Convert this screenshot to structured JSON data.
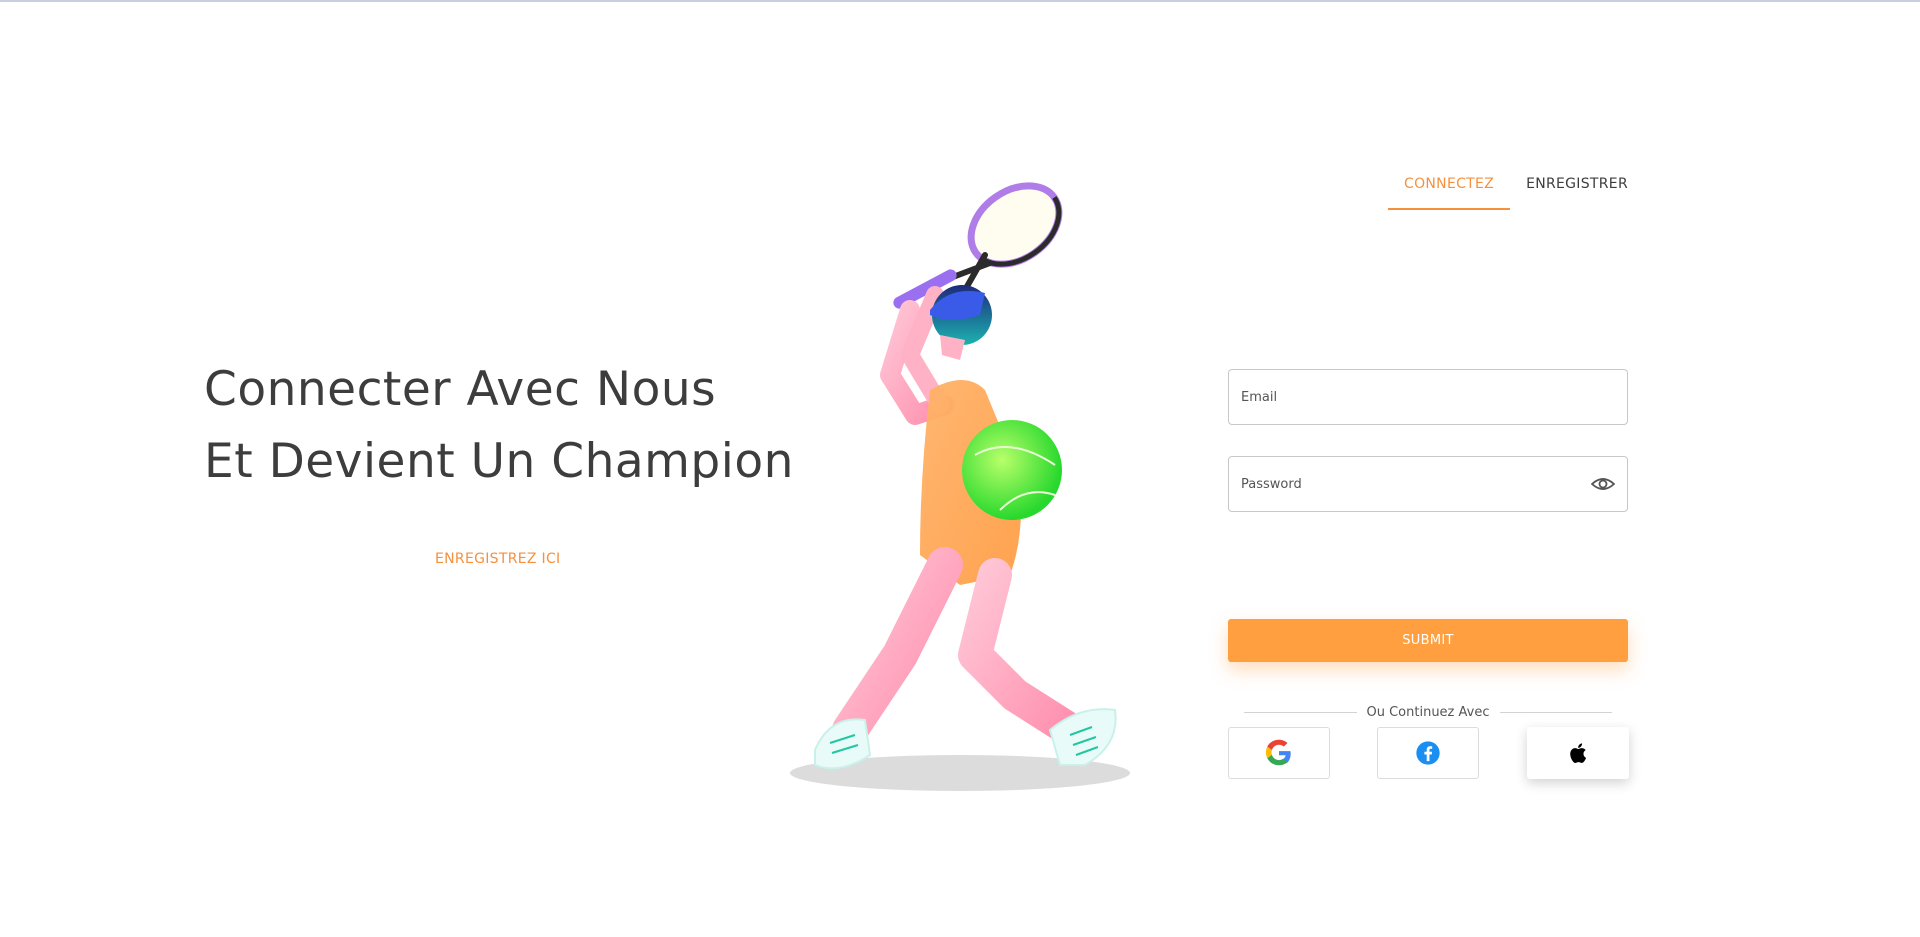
{
  "hero": {
    "line1": "Connecter Avec Nous",
    "line2": "Et Devient Un Champion",
    "register_link": "ENREGISTREZ ICI"
  },
  "tabs": [
    {
      "label": "CONNECTEZ",
      "active": true
    },
    {
      "label": "ENREGISTRER",
      "active": false
    }
  ],
  "form": {
    "email": {
      "placeholder": "Email",
      "value": ""
    },
    "password": {
      "placeholder": "Password",
      "value": ""
    },
    "submit_label": "SUBMIT",
    "divider_text": "Ou Continuez Avec"
  },
  "social": [
    {
      "name": "google-icon"
    },
    {
      "name": "facebook-icon"
    },
    {
      "name": "apple-icon"
    }
  ],
  "colors": {
    "accent": "#ff9f3f",
    "text": "#3d3d3d",
    "facebook": "#1b8ef2"
  }
}
